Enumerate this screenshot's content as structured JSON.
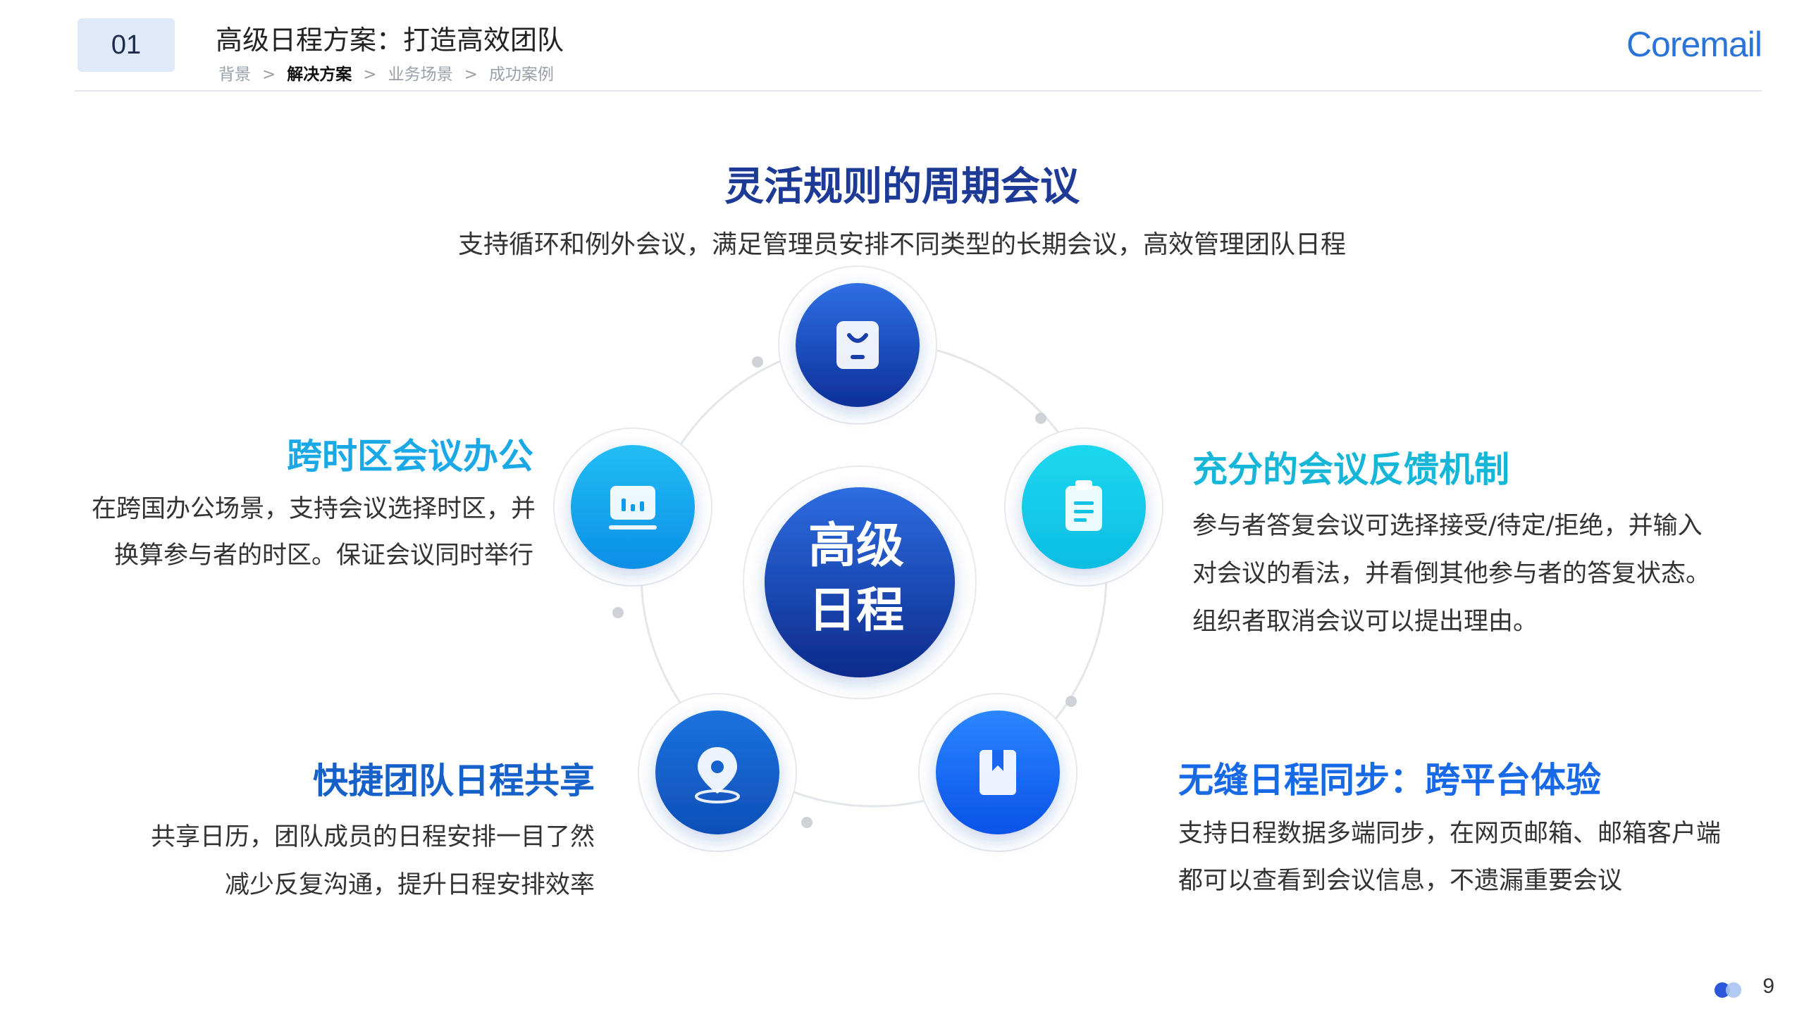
{
  "header": {
    "chapter_number": "01",
    "title": "高级日程方案：打造高效团队",
    "breadcrumb": [
      "背景",
      "解决方案",
      "业务场景",
      "成功案例"
    ],
    "breadcrumb_separator": ">",
    "breadcrumb_active_index": 1,
    "logo_text": "Coremail"
  },
  "main": {
    "title": "灵活规则的周期会议",
    "description": "支持循环和例外会议，满足管理员安排不同类型的长期会议，高效管理团队日程"
  },
  "center": {
    "line1": "高级",
    "line2": "日程"
  },
  "features": {
    "left_top": {
      "title": "跨时区会议办公",
      "lines": [
        "在跨国办公场景，支持会议选择时区，并",
        "换算参与者的时区。保证会议同时举行"
      ]
    },
    "right_top": {
      "title": "充分的会议反馈机制",
      "lines": [
        "参与者答复会议可选择接受/待定/拒绝，并输入",
        "对会议的看法，并看倒其他参与者的答复状态。",
        "组织者取消会议可以提出理由。"
      ]
    },
    "left_bottom": {
      "title": "快捷团队日程共享",
      "lines": [
        "共享日历，团队成员的日程安排一目了然",
        "减少反复沟通，提升日程安排效率"
      ]
    },
    "right_bottom": {
      "title": "无缝日程同步：跨平台体验",
      "lines": [
        "支持日程数据多端同步，在网页邮箱、邮箱客户端",
        "都可以查看到会议信息，不遗漏重要会议"
      ]
    }
  },
  "icons": {
    "top": "id-badge-icon",
    "left": "chart-monitor-icon",
    "right": "clipboard-icon",
    "bottom_left": "location-pin-icon",
    "bottom_right": "bookmark-icon"
  },
  "colors": {
    "title_dark_blue": "#1d3a96",
    "cyan": "#16b6d8",
    "sky_blue": "#1aa8e6",
    "blue": "#1560c9",
    "bright_blue": "#1769e6"
  },
  "footer": {
    "page_number": "9"
  }
}
